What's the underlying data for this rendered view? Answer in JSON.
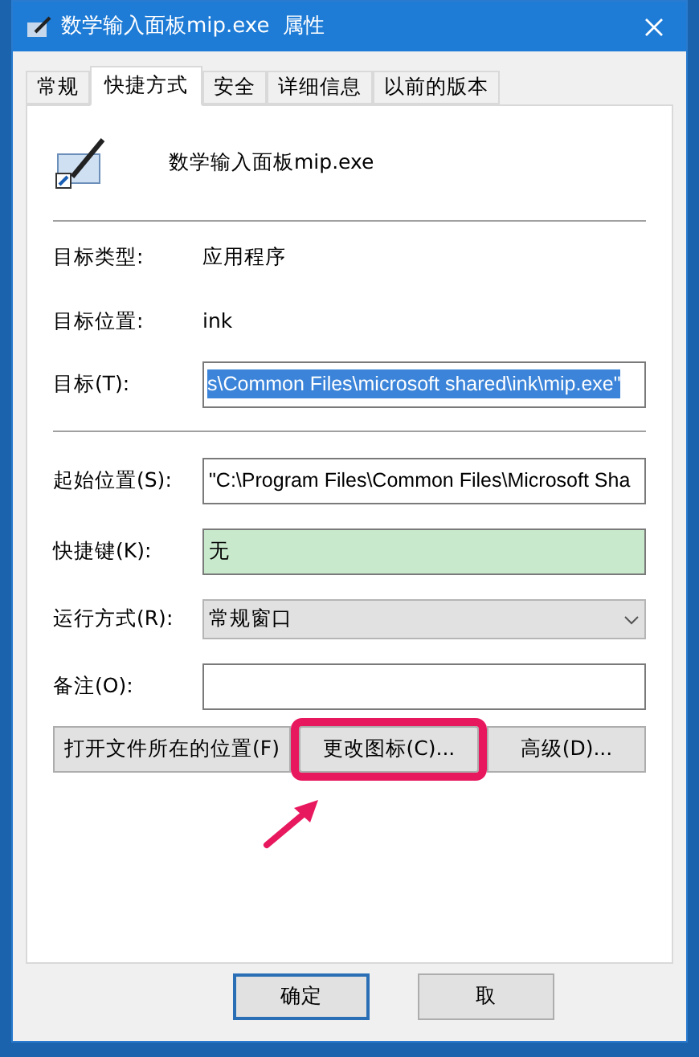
{
  "window": {
    "title": "数学输入面板mip.exe  属性"
  },
  "tabs": [
    {
      "label": "常规",
      "selected": false
    },
    {
      "label": "快捷方式",
      "selected": true
    },
    {
      "label": "安全",
      "selected": false
    },
    {
      "label": "详细信息",
      "selected": false
    },
    {
      "label": "以前的版本",
      "selected": false
    }
  ],
  "header": {
    "name": "数学输入面板mip.exe"
  },
  "info": [
    {
      "label": "目标类型:",
      "value": "应用程序"
    },
    {
      "label": "目标位置:",
      "value": "ink"
    }
  ],
  "target": {
    "label": "目标(T):",
    "value": "s\\Common Files\\microsoft shared\\ink\\mip.exe\""
  },
  "fields": [
    {
      "kind": "text",
      "label": "起始位置(S):",
      "value": "\"C:\\Program Files\\Common Files\\Microsoft Sha"
    },
    {
      "kind": "hotkey",
      "label": "快捷键(K):",
      "value": "无"
    },
    {
      "kind": "dropdown",
      "label": "运行方式(R):",
      "value": "常规窗口"
    },
    {
      "kind": "text",
      "label": "备注(O):"
    }
  ],
  "actions": [
    {
      "label": "打开文件所在的位置(F)",
      "highlighted": false
    },
    {
      "label": "更改图标(C)...",
      "highlighted": true
    },
    {
      "label": "高级(D)...",
      "highlighted": false
    }
  ],
  "dialog_buttons": [
    {
      "label": "确定",
      "default": true
    },
    {
      "label": "取",
      "default": false
    }
  ]
}
